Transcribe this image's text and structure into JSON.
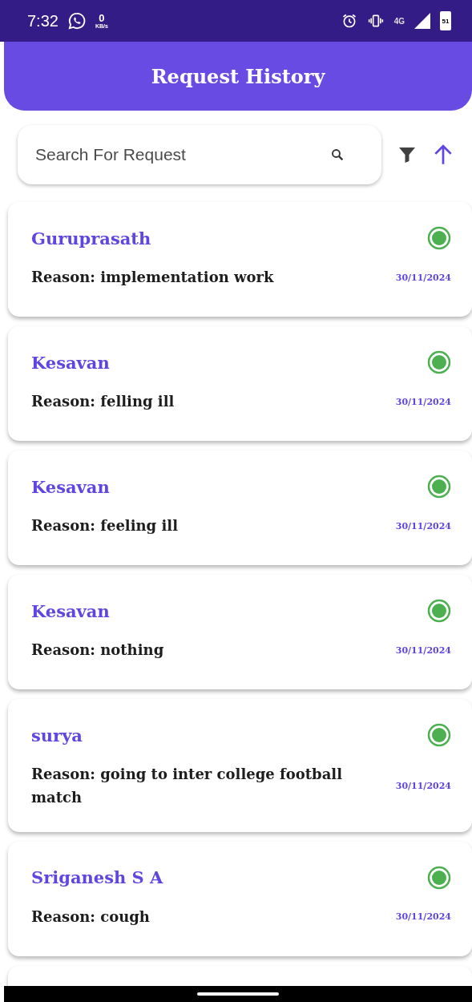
{
  "status_bar": {
    "time": "7:32",
    "data_rate": "0",
    "data_unit": "KB/s",
    "network": "4G",
    "battery": "51"
  },
  "header": {
    "title": "Request History"
  },
  "search": {
    "placeholder": "Search For Request"
  },
  "requests": [
    {
      "name": "Guruprasath",
      "reason": "Reason: implementation work",
      "date": "30/11/2024"
    },
    {
      "name": "Kesavan",
      "reason": "Reason: felling ill",
      "date": "30/11/2024"
    },
    {
      "name": "Kesavan",
      "reason": "Reason: feeling ill",
      "date": "30/11/2024"
    },
    {
      "name": "Kesavan",
      "reason": "Reason: nothing",
      "date": "30/11/2024"
    },
    {
      "name": "surya",
      "reason": "Reason: going to inter college football match",
      "date": "30/11/2024"
    },
    {
      "name": "Sriganesh S A",
      "reason": "Reason: cough",
      "date": "30/11/2024"
    }
  ]
}
